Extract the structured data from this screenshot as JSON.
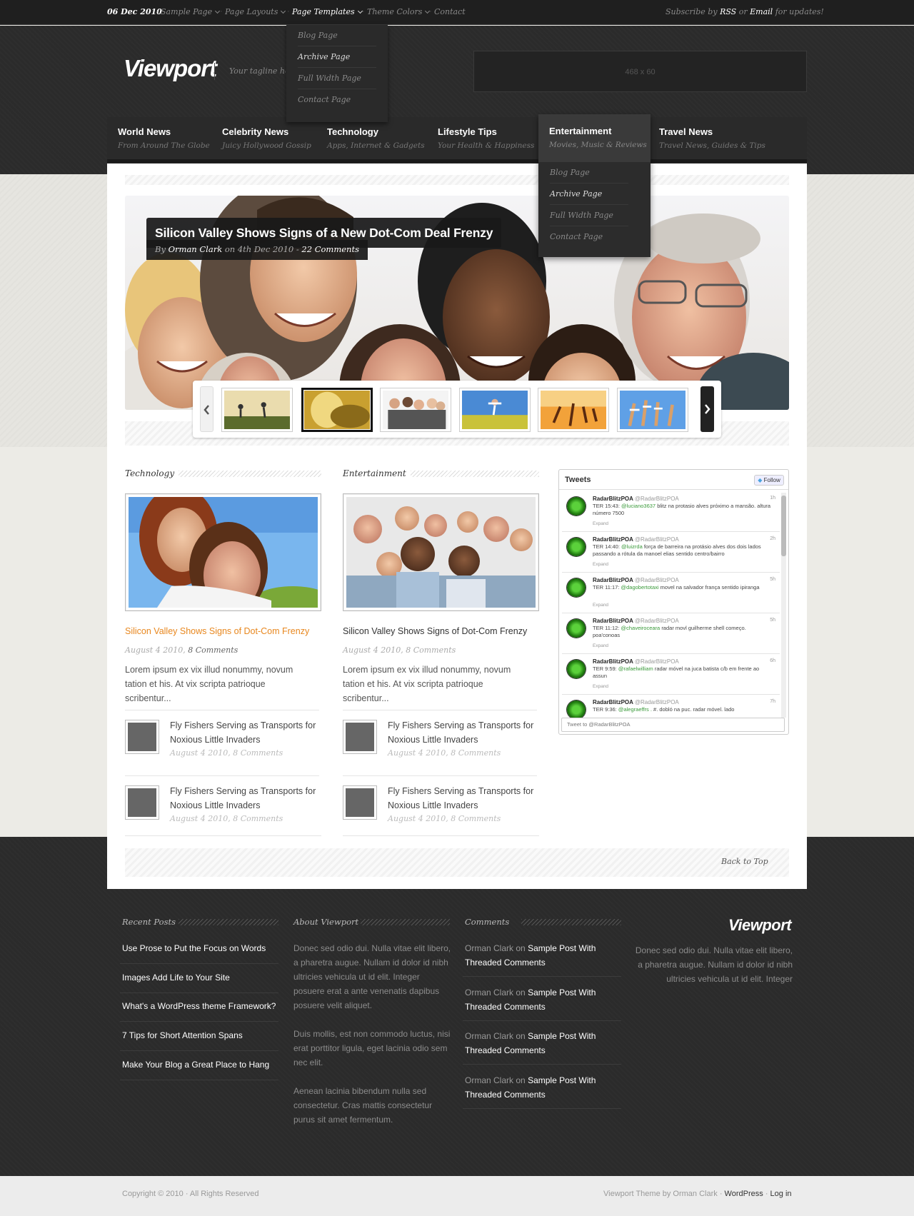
{
  "topbar": {
    "date": "06 Dec 2010",
    "links": [
      "Sample Page",
      "Page Layouts",
      "Page Templates",
      "Theme Colors",
      "Contact"
    ],
    "subscribe_prefix": "Subscribe by",
    "subscribe_rss": "RSS",
    "subscribe_or": "or",
    "subscribe_email": "Email",
    "subscribe_suffix": "for updates!"
  },
  "header": {
    "logo": "Viewport",
    "tagline": "Your tagline here",
    "ad_label": "468 x 60"
  },
  "page_templates_menu": [
    "Blog Page",
    "Archive Page",
    "Full Width Page",
    "Contact Page"
  ],
  "nav": [
    {
      "title": "World News",
      "sub": "From Around The Globe"
    },
    {
      "title": "Celebrity News",
      "sub": "Juicy Hollywood Gossip"
    },
    {
      "title": "Technology",
      "sub": "Apps, Internet & Gadgets"
    },
    {
      "title": "Lifestyle Tips",
      "sub": "Your Health & Happiness"
    },
    {
      "title": "Entertainment",
      "sub": "Movies, Music & Reviews"
    },
    {
      "title": "Travel News",
      "sub": "Travel News, Guides & Tips"
    }
  ],
  "entertainment_menu": [
    "Blog Page",
    "Archive Page",
    "Full Width Page",
    "Contact Page"
  ],
  "featured": {
    "title": "Silicon Valley Shows Signs of a New Dot-Com Deal Frenzy",
    "meta_by": "By",
    "author": "Orman Clark",
    "meta_on": "on",
    "date": "4th Dec 2010",
    "dash": "-",
    "comments": "22 Comments"
  },
  "columns": [
    {
      "heading": "Technology",
      "post_title": "Silicon Valley Shows Signs of Dot-Com Frenzy",
      "post_date": "August 4 2010,",
      "post_comments": "8 Comments",
      "excerpt": "Lorem ipsum ex vix illud nonummy, novum tation et his. At vix scripta patrioque scribentur...",
      "minis": [
        {
          "title": "Fly Fishers Serving as Transports for Noxious Little Invaders",
          "meta": "August 4 2010, 8 Comments"
        },
        {
          "title": "Fly Fishers Serving as Transports for Noxious Little Invaders",
          "meta": "August 4 2010, 8 Comments"
        }
      ]
    },
    {
      "heading": "Entertainment",
      "post_title": "Silicon Valley Shows Signs of Dot-Com Frenzy",
      "post_date": "August 4 2010,",
      "post_comments": "8 Comments",
      "excerpt": "Lorem ipsum ex vix illud nonummy, novum tation et his. At vix scripta patrioque scribentur...",
      "minis": [
        {
          "title": "Fly Fishers Serving as Transports for Noxious Little Invaders",
          "meta": "August 4 2010, 8 Comments"
        },
        {
          "title": "Fly Fishers Serving as Transports for Noxious Little Invaders",
          "meta": "August 4 2010, 8 Comments"
        }
      ]
    }
  ],
  "tweets_widget": {
    "title": "Tweets",
    "follow": "Follow",
    "input_placeholder": "Tweet to @RadarBlitzPOA",
    "expand_label": "Expand",
    "tweets": [
      {
        "name": "RadarBlitzPOA",
        "handle": "@RadarBlitzPOA",
        "time": "1h",
        "prefix": "TER 15:43:",
        "mention": "@luciano3637",
        "text": "blitz na protasio alves próximo a mansão. altura número 7500"
      },
      {
        "name": "RadarBlitzPOA",
        "handle": "@RadarBlitzPOA",
        "time": "2h",
        "prefix": "TER 14:40:",
        "mention": "@luizrda",
        "text": "força de barreira na protásio alves dos dois lados passando a rótula da manoel elias sentido centro/bairro"
      },
      {
        "name": "RadarBlitzPOA",
        "handle": "@RadarBlitzPOA",
        "time": "5h",
        "prefix": "TER 11:17:",
        "mention": "@dagobertotaxi",
        "text": "movel na salvador frança sentido ipiranga"
      },
      {
        "name": "RadarBlitzPOA",
        "handle": "@RadarBlitzPOA",
        "time": "5h",
        "prefix": "TER 11:12:",
        "mention": "@chaveiroceara",
        "text": "radar movl guilherme shell começo. poa'conoas"
      },
      {
        "name": "RadarBlitzPOA",
        "handle": "@RadarBlitzPOA",
        "time": "6h",
        "prefix": "TER 9:59:",
        "mention": "@rafaelwilliam",
        "text": "radar móvel na juca batista c/b em frente ao assun"
      },
      {
        "name": "RadarBlitzPOA",
        "handle": "@RadarBlitzPOA",
        "time": "7h",
        "prefix": "TER 9:36:",
        "mention": "@alegraeffrs .",
        "text": "#. dobló na puc. radar móvel. lado"
      }
    ]
  },
  "back_to_top": "Back to Top",
  "footer": {
    "recent_posts_title": "Recent Posts",
    "recent_posts": [
      "Use Prose to Put the Focus on Words",
      "Images Add Life to Your Site",
      "What's a WordPress theme Framework?",
      "7 Tips for Short Attention Spans",
      "Make Your Blog a Great Place to Hang"
    ],
    "about_title": "About Viewport",
    "about_paragraphs": [
      "Donec sed odio dui. Nulla vitae elit libero, a pharetra augue. Nullam id dolor id nibh ultricies vehicula ut id elit. Integer posuere erat a ante venenatis dapibus posuere velit aliquet.",
      "Duis mollis, est non commodo luctus, nisi erat porttitor ligula, eget lacinia odio sem nec elit.",
      "Aenean lacinia bibendum nulla sed consectetur. Cras mattis consectetur purus sit amet fermentum."
    ],
    "comments_title": "Comments",
    "comments": [
      {
        "author": "Orman Clark",
        "on": "on",
        "post": "Sample Post With Threaded Comments"
      },
      {
        "author": "Orman Clark",
        "on": "on",
        "post": "Sample Post With Threaded Comments"
      },
      {
        "author": "Orman Clark",
        "on": "on",
        "post": "Sample Post With Threaded Comments"
      },
      {
        "author": "Orman Clark",
        "on": "on",
        "post": "Sample Post With Threaded Comments"
      }
    ],
    "logo": "Viewport",
    "about_text": "Donec sed odio dui. Nulla vitae elit libero, a pharetra augue. Nullam id dolor id nibh ultricies vehicula ut id elit. Integer"
  },
  "bottom": {
    "copyright": "Copyright © 2010 · All Rights Reserved",
    "credit_prefix": "Viewport Theme by Orman Clark ·",
    "wordpress": "WordPress",
    "dot": "·",
    "login": "Log in"
  },
  "colors": {
    "accent": "#e8871e",
    "dark": "#2b2b2b",
    "twitter_green": "#3a9a3a"
  }
}
